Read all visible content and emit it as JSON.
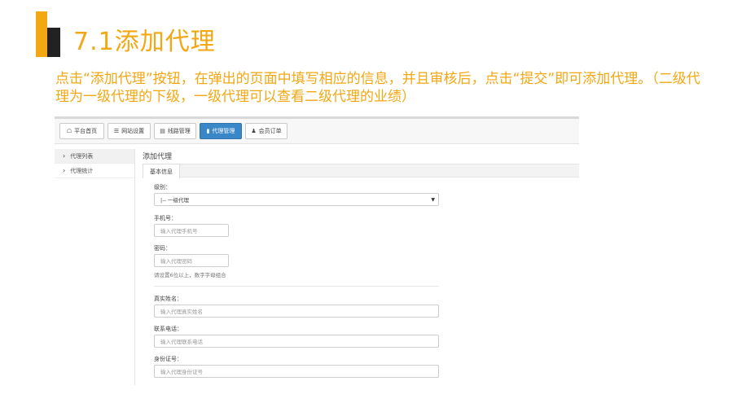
{
  "slide": {
    "title": "7.1添加代理",
    "description": "点击“添加代理”按钮，在弹出的页面中填写相应的信息，并且审核后，点击“提交”即可添加代理。（二级代理为一级代理的下级，一级代理可以查看二级代理的业绩）"
  },
  "navbar": {
    "buttons": [
      {
        "icon": "home-icon",
        "label": "平台首页"
      },
      {
        "icon": "list-icon",
        "label": "网站设置"
      },
      {
        "icon": "folder-icon",
        "label": "线路管理"
      },
      {
        "icon": "book-icon",
        "label": "代理管理"
      },
      {
        "icon": "user-icon",
        "label": "会员订单"
      }
    ],
    "active_index": 3
  },
  "sidebar": {
    "items": [
      {
        "label": "代理列表"
      },
      {
        "label": "代理统计"
      }
    ]
  },
  "main": {
    "heading": "添加代理",
    "tab_label": "基本信息",
    "form": {
      "level_label": "级别：",
      "level_value": "|-- 一级代理",
      "phone_label": "手机号：",
      "phone_placeholder": "输入代理手机号",
      "password_label": "密码：",
      "password_placeholder": "输入代理密码",
      "password_hint": "请设置6位以上，数字字母组合",
      "realname_label": "真实姓名：",
      "realname_placeholder": "输入代理真实姓名",
      "contact_label": "联系电话：",
      "contact_placeholder": "输入代理联系电话",
      "idcard_label": "身份证号：",
      "idcard_placeholder": "输入代理身份证号"
    }
  },
  "colors": {
    "accent_orange": "#f3a712",
    "active_button": "#3a87c8"
  }
}
